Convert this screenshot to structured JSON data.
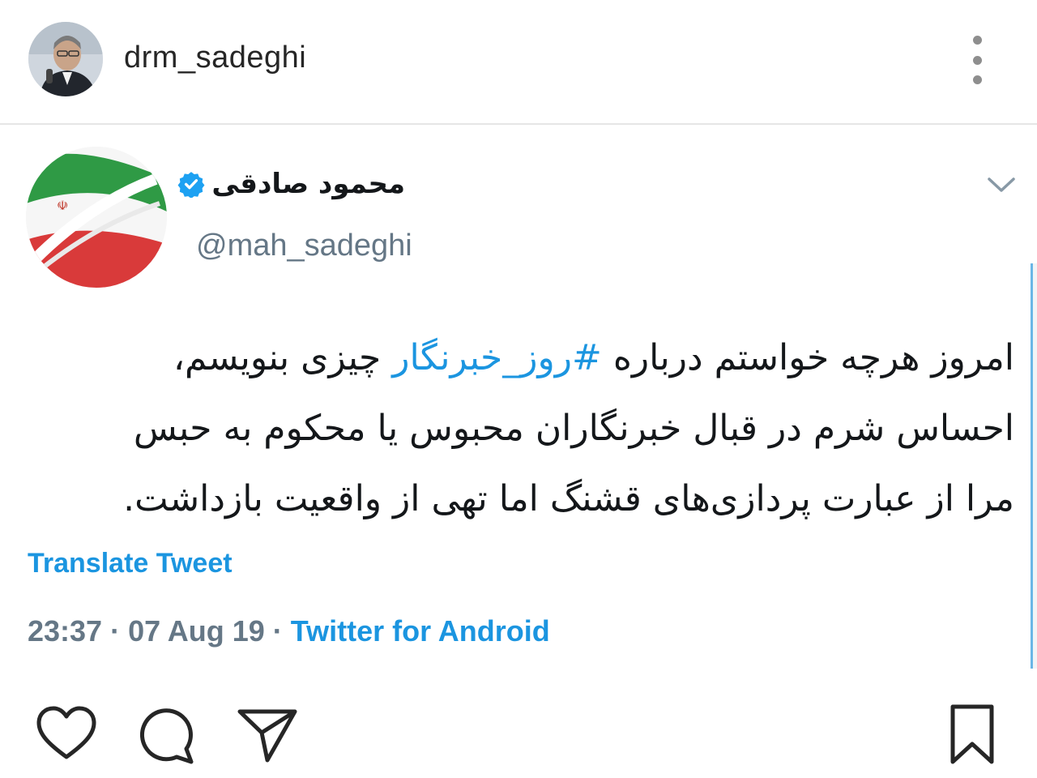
{
  "post": {
    "username": "drm_sadeghi"
  },
  "tweet": {
    "display_name": "محمود صادقی",
    "handle": "@mah_sadeghi",
    "text_line1_before": "امروز هرچه خواستم درباره ",
    "hashtag": "#روز_خبرنگار",
    "text_line1_after": " چیزی بنویسم،",
    "text_line2": "احساس شرم در قبال خبرنگاران محبوس یا محکوم به حبس",
    "text_line3": "مرا از عبارت پردازی‌های قشنگ اما تهی از واقعیت بازداشت.",
    "translate_label": "Translate Tweet",
    "timestamp": "23:37 · 07 Aug 19 · ",
    "source": "Twitter for Android"
  },
  "icons": {
    "post_header": [
      "avatar",
      "more-options-icon"
    ],
    "tweet": [
      "verified-badge-icon",
      "chevron-down-icon"
    ],
    "actions": [
      "heart-icon",
      "comment-icon",
      "share-icon",
      "bookmark-icon"
    ]
  },
  "colors": {
    "twitter_blue": "#1b95e0",
    "text_primary": "#14171a",
    "text_secondary": "#657786",
    "ig_text": "#262626"
  }
}
